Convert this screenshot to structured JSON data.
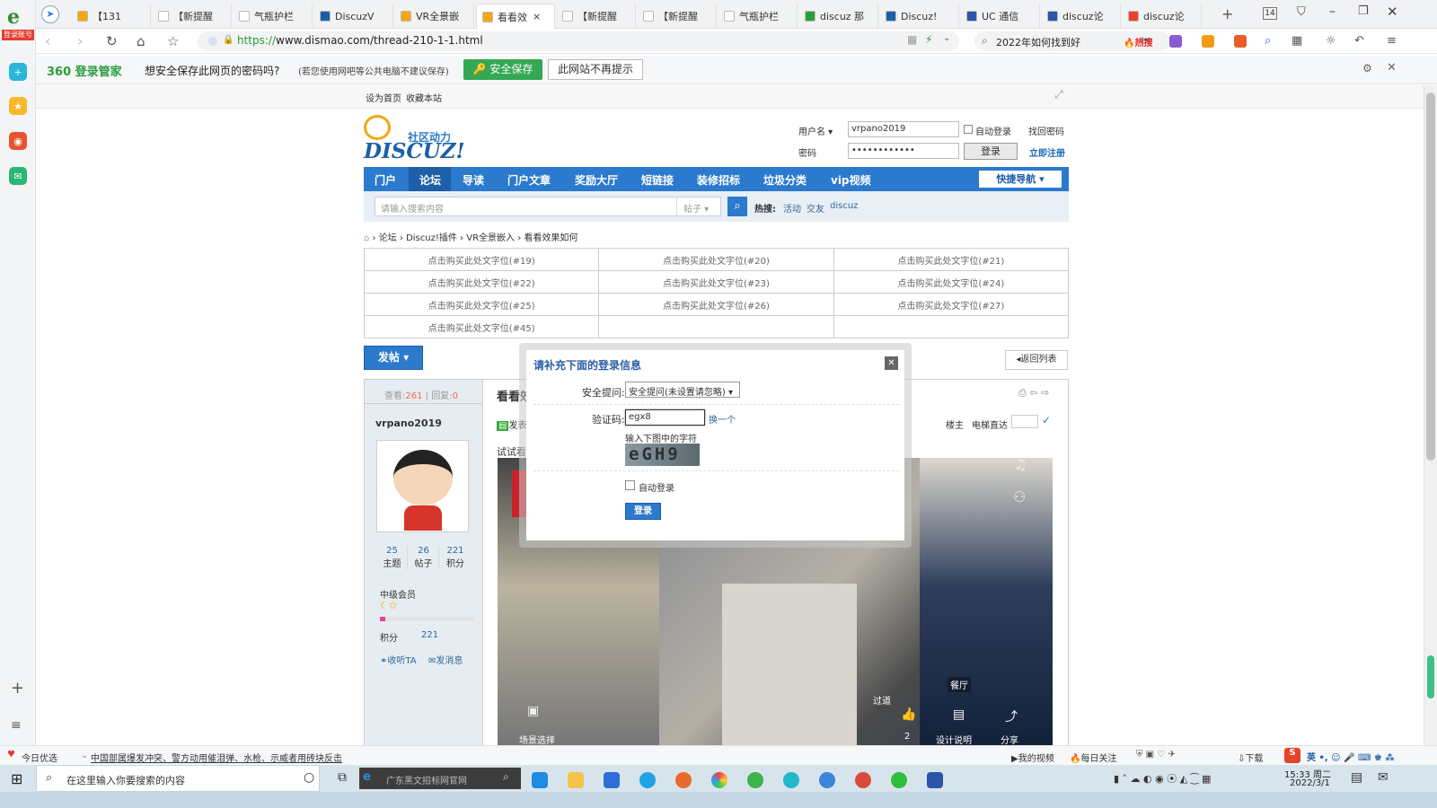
{
  "rail": {
    "login_label": "登录账号"
  },
  "tabs": [
    {
      "label": "【131"
    },
    {
      "label": "【新提醒"
    },
    {
      "label": "气瓶护栏"
    },
    {
      "label": "DiscuzV"
    },
    {
      "label": "VR全景嵌"
    },
    {
      "label": "看看效",
      "close": "×"
    },
    {
      "label": "【新提醒"
    },
    {
      "label": "【新提醒"
    },
    {
      "label": "气瓶护栏"
    },
    {
      "label": "discuz 那"
    },
    {
      "label": "Discuz!"
    },
    {
      "label": "UC 通信"
    },
    {
      "label": "discuz论"
    },
    {
      "label": "discuz论"
    }
  ],
  "tabcount": "14",
  "nav": {
    "url": "https://www.dismao.com/thread-210-1-1.html",
    "url_scheme": "https://",
    "url_rest": "www.dismao.com/thread-210-1-1.html",
    "hot_search": "2022年如何找到好",
    "hot_tag": "热搜"
  },
  "pwbar": {
    "brand": "360 登录管家",
    "question": "想安全保存此网页的密码吗?",
    "note": "(若您使用网吧等公共电脑不建议保存)",
    "save_btn": "安全保存",
    "never_btn": "此网站不再提示"
  },
  "site": {
    "set_home": "设为首页",
    "bookmark": "收藏本站",
    "logo_sub": "社区动力",
    "logo_main": "DISCUZ!",
    "username_label": "用户名",
    "username_value": "vrpano2019",
    "password_label": "密码",
    "password_value": "••••••••••••",
    "auto_login": "自动登录",
    "forgot": "找回密码",
    "login_btn": "登录",
    "register": "立即注册",
    "menu": [
      "门户",
      "论坛",
      "导读",
      "门户文章",
      "奖励大厅",
      "短链接",
      "装修招标",
      "垃圾分类",
      "vip视频"
    ],
    "quick_nav": "快捷导航",
    "search_placeholder": "请输入搜索内容",
    "search_type": "帖子",
    "hot_label": "热搜:",
    "hot_words": [
      "活动",
      "交友",
      "discuz"
    ],
    "breadcrumb": [
      "论坛",
      "Discuz!插件",
      "VR全景嵌入",
      "看看效果如何"
    ],
    "ads": [
      [
        "点击购买此处文字位(#19)",
        "点击购买此处文字位(#20)",
        "点击购买此处文字位(#21)"
      ],
      [
        "点击购买此处文字位(#22)",
        "点击购买此处文字位(#23)",
        "点击购买此处文字位(#24)"
      ],
      [
        "点击购买此处文字位(#25)",
        "点击购买此处文字位(#26)",
        "点击购买此处文字位(#27)"
      ],
      [
        "点击购买此处文字位(#45)",
        "",
        ""
      ]
    ],
    "post_btn": "发帖",
    "back_list": "返回列表",
    "views_label": "查看:",
    "views": "261",
    "replies_label": "回复:",
    "replies": "0",
    "thread_title": "看看效",
    "author": "vrpano2019",
    "stats": [
      {
        "v": "25",
        "l": "主题"
      },
      {
        "v": "26",
        "l": "帖子"
      },
      {
        "v": "221",
        "l": "积分"
      }
    ],
    "rank": "中级会员",
    "points_label": "积分",
    "points": "221",
    "follow": "收听TA",
    "message": "发消息",
    "post_prefix": "发表",
    "post_body": "试试看",
    "floor_owner": "楼主",
    "elevator": "电梯直达",
    "vr_labels": {
      "transition": "过道",
      "dining": "餐厅",
      "scene": "场景选择",
      "likes": "2",
      "design": "设计说明",
      "share": "分享"
    }
  },
  "modal": {
    "title": "请补充下面的登录信息",
    "q_label": "安全提问:",
    "q_value": "安全提问(未设置请忽略)",
    "captcha_label": "验证码:",
    "captcha_value": "egx8",
    "change": "换一个",
    "hint": "输入下图中的字符",
    "captcha_img": "eGH9",
    "auto_login": "自动登录",
    "submit": "登录"
  },
  "bottombar": {
    "today": "今日优选",
    "news": "中国部属爆发冲突、警方动用催泪弹、水枪、示威者用砖块反击",
    "video": "我的视频",
    "daily": "每日关注",
    "download": "下载"
  },
  "taskbar": {
    "search_placeholder": "在这里输入你要搜索的内容",
    "app_search": "广东黑文招标网官网",
    "time": "15:33 周二",
    "date": "2022/3/1",
    "ime": "英"
  }
}
